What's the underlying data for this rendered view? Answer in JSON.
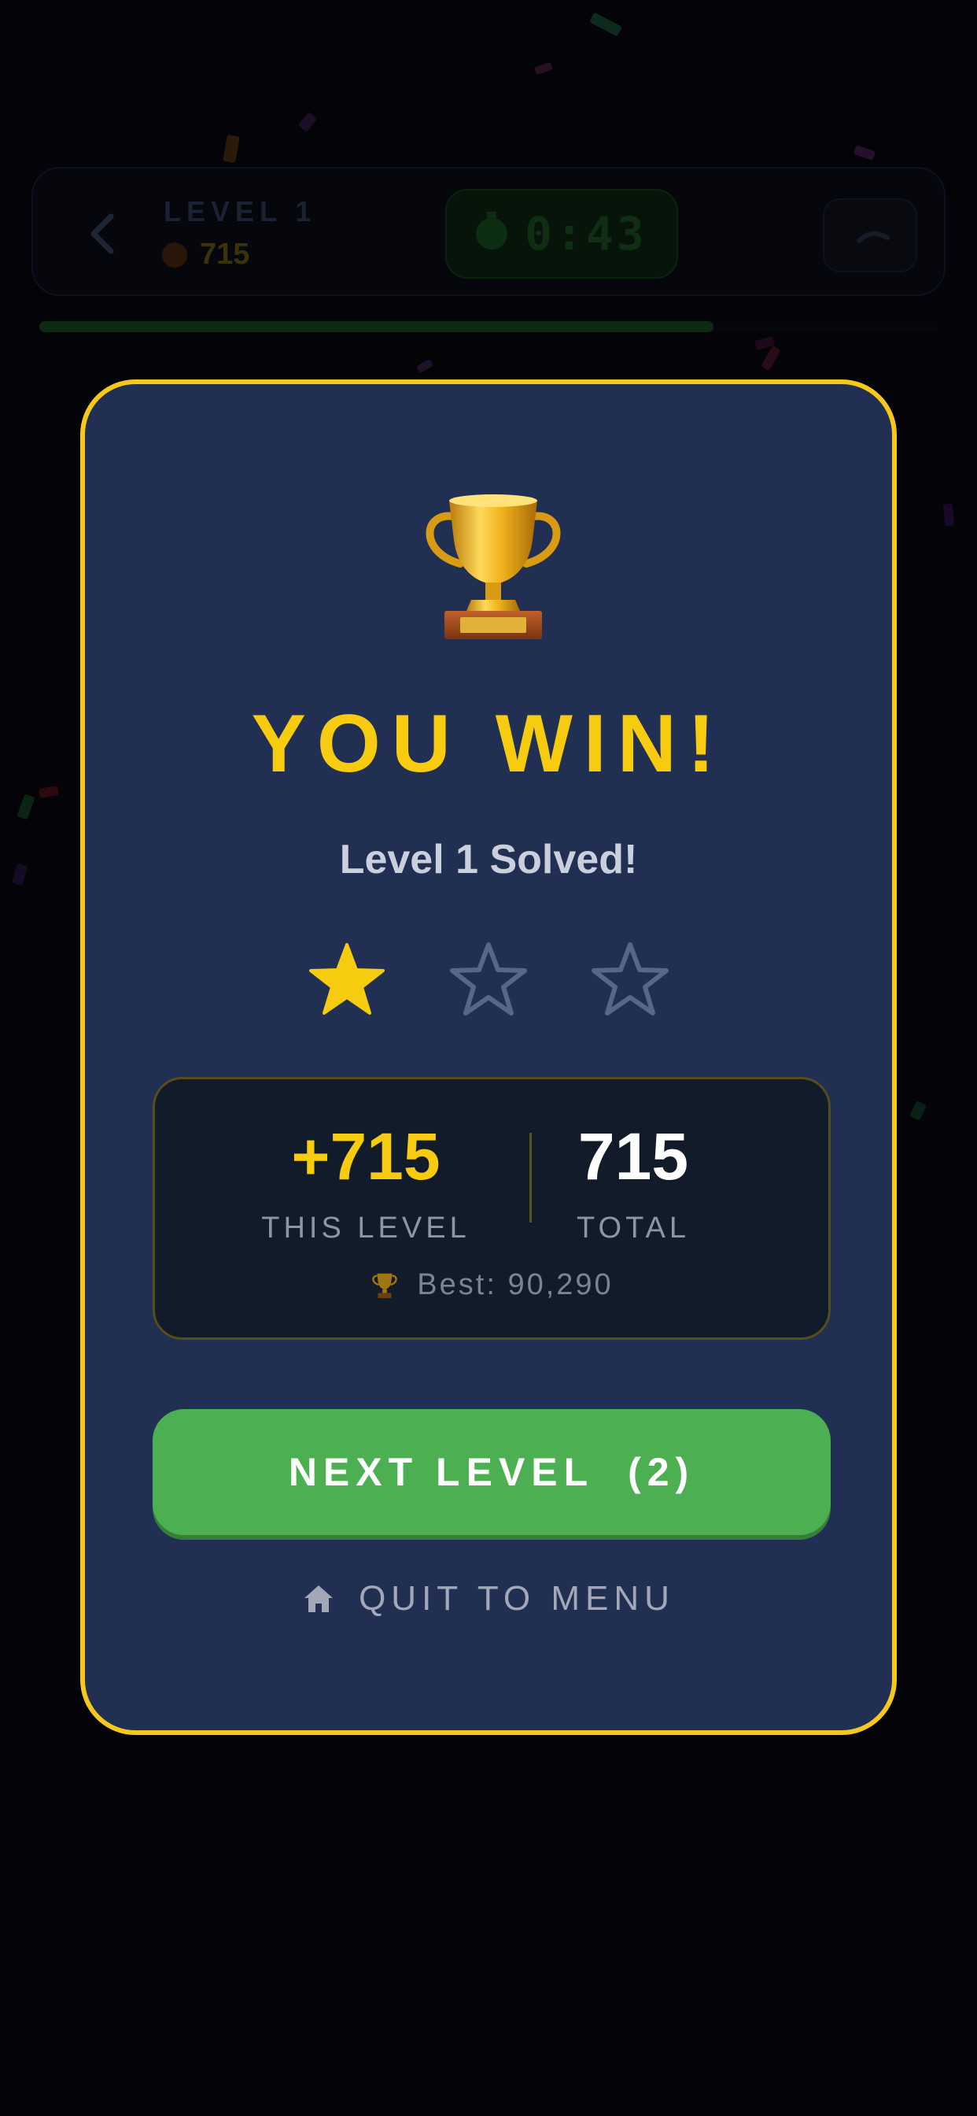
{
  "background_hud": {
    "level_label": "LEVEL 1",
    "score": "715",
    "score_icon": "darts-icon",
    "timer": "0:43",
    "timer_icon": "stopwatch-icon",
    "back_icon": "chevron-left-icon",
    "undo_icon": "undo-icon",
    "progress_fraction": 0.75
  },
  "modal": {
    "trophy_icon": "trophy-icon",
    "title": "YOU WIN!",
    "subtitle": "Level 1 Solved!",
    "stars_earned": 1,
    "stars_total": 3,
    "score_this_level": "+715",
    "score_this_level_label": "THIS LEVEL",
    "score_total": "715",
    "score_total_label": "TOTAL",
    "best_icon": "trophy-icon",
    "best_text": "Best: 90,290",
    "next_button_label": "NEXT LEVEL  (2)",
    "quit_icon": "home-icon",
    "quit_label": "QUIT TO MENU"
  },
  "colors": {
    "accent_gold": "#f7cc10",
    "modal_bg": "#213052",
    "button_green": "#4cb052",
    "star_empty": "#56678a"
  }
}
